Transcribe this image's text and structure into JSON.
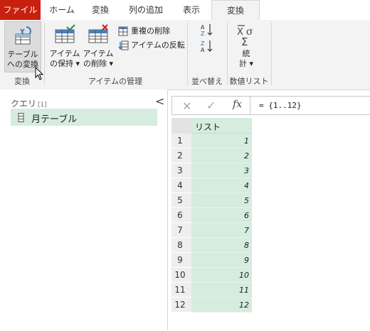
{
  "tabs": [
    {
      "label": "ファイル"
    },
    {
      "label": "ホーム"
    },
    {
      "label": "変換"
    },
    {
      "label": "列の追加"
    },
    {
      "label": "表示"
    },
    {
      "label": "変換"
    }
  ],
  "ribbon": {
    "convert_group": {
      "button_line1": "テーブル",
      "button_line2": "への変換",
      "label": "変換"
    },
    "items_group": {
      "keep_line1": "アイテム",
      "keep_line2": "の保持 ▾",
      "remove_line1": "アイテム",
      "remove_line2": "の削除 ▾",
      "remove_dup": "重複の削除",
      "reverse": "アイテムの反転",
      "label": "アイテムの管理"
    },
    "sort_group": {
      "label": "並べ替え"
    },
    "stats_group": {
      "button_line1": "統",
      "button_line2": "計 ▾",
      "label": "数値リスト"
    }
  },
  "query_pane": {
    "title": "クエリ",
    "count": "[1]",
    "collapse": "<",
    "items": [
      {
        "name": "月テーブル"
      }
    ]
  },
  "formula_bar": {
    "cancel": "✕",
    "confirm": "✓",
    "fx": "fx",
    "formula": "= {1..12}"
  },
  "table": {
    "column_header": "リスト",
    "rows": [
      {
        "num": "1",
        "value": "1"
      },
      {
        "num": "2",
        "value": "2"
      },
      {
        "num": "3",
        "value": "3"
      },
      {
        "num": "4",
        "value": "4"
      },
      {
        "num": "5",
        "value": "5"
      },
      {
        "num": "6",
        "value": "6"
      },
      {
        "num": "7",
        "value": "7"
      },
      {
        "num": "8",
        "value": "8"
      },
      {
        "num": "9",
        "value": "9"
      },
      {
        "num": "10",
        "value": "10"
      },
      {
        "num": "11",
        "value": "11"
      },
      {
        "num": "12",
        "value": "12"
      }
    ]
  },
  "colors": {
    "file_tab": "#c8200f",
    "selection_green": "#d5ecdf",
    "ribbon_bg": "#f3f3f3"
  }
}
